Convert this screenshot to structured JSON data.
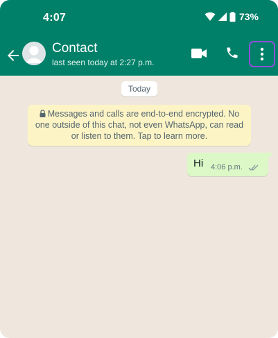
{
  "status_bar": {
    "time": "4:07",
    "battery": "73%",
    "icons": [
      "wifi-icon",
      "signal-icon",
      "battery-icon"
    ]
  },
  "header": {
    "contact_name": "Contact",
    "last_seen": "last seen today at 2:27 p.m.",
    "icons": [
      "back-arrow-icon",
      "avatar-icon",
      "video-call-icon",
      "phone-icon",
      "more-vert-icon"
    ]
  },
  "chat": {
    "date_chip": "Today",
    "encryption_notice": "Messages and calls are end-to-end encrypted. No one outside of this chat, not even WhatsApp, can read or listen to them. Tap to learn more.",
    "messages": [
      {
        "text": "Hi",
        "time": "4:06 p.m.",
        "direction": "outgoing",
        "status": "read-double-tick"
      }
    ]
  },
  "colors": {
    "header": "#008069",
    "chat_background": "#efe7dd",
    "outgoing_bubble": "#dcf8c6",
    "notice_background": "#fdf4c5",
    "highlight_outline": "#8e4fd8"
  }
}
